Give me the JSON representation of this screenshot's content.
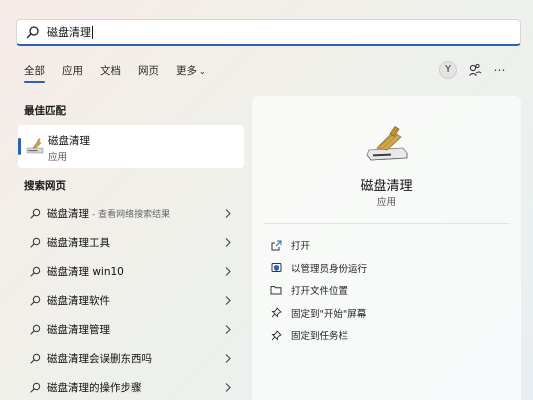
{
  "search": {
    "query": "磁盘清理"
  },
  "tabs": [
    {
      "label": "全部"
    },
    {
      "label": "应用"
    },
    {
      "label": "文档"
    },
    {
      "label": "网页"
    },
    {
      "label": "更多"
    }
  ],
  "account": {
    "initial": "Y"
  },
  "best_match": {
    "title": "最佳匹配",
    "name": "磁盘清理",
    "type": "应用"
  },
  "web": {
    "title": "搜索网页",
    "items": [
      {
        "label": "磁盘清理",
        "sub": "- 查看网络搜索结果"
      },
      {
        "label": "磁盘清理工具",
        "sub": ""
      },
      {
        "label": "磁盘清理 win10",
        "sub": ""
      },
      {
        "label": "磁盘清理软件",
        "sub": ""
      },
      {
        "label": "磁盘清理管理",
        "sub": ""
      },
      {
        "label": "磁盘清理会误删东西吗",
        "sub": ""
      },
      {
        "label": "磁盘清理的操作步骤",
        "sub": ""
      }
    ]
  },
  "detail": {
    "name": "磁盘清理",
    "type": "应用",
    "actions": [
      {
        "label": "打开",
        "icon": "open-icon"
      },
      {
        "label": "以管理员身份运行",
        "icon": "shield-admin-icon"
      },
      {
        "label": "打开文件位置",
        "icon": "folder-icon"
      },
      {
        "label": "固定到\"开始\"屏幕",
        "icon": "pin-icon"
      },
      {
        "label": "固定到任务栏",
        "icon": "pin-icon"
      }
    ]
  },
  "colors": {
    "accent": "#2b62b8"
  }
}
